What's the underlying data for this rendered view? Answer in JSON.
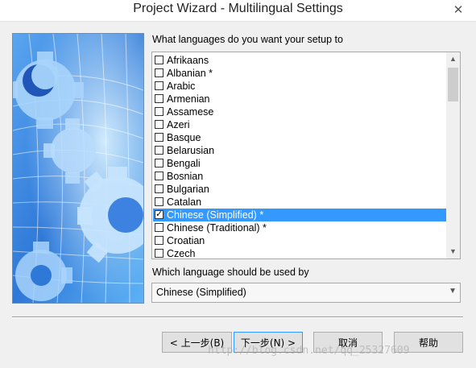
{
  "window": {
    "title": "Project Wizard - Multilingual Settings",
    "close_glyph": "✕"
  },
  "languages_prompt": "What languages do you want your setup to",
  "languages": [
    {
      "label": "Afrikaans",
      "checked": false,
      "selected": false
    },
    {
      "label": "Albanian *",
      "checked": false,
      "selected": false
    },
    {
      "label": "Arabic",
      "checked": false,
      "selected": false
    },
    {
      "label": "Armenian",
      "checked": false,
      "selected": false
    },
    {
      "label": "Assamese",
      "checked": false,
      "selected": false
    },
    {
      "label": "Azeri",
      "checked": false,
      "selected": false
    },
    {
      "label": "Basque",
      "checked": false,
      "selected": false
    },
    {
      "label": "Belarusian",
      "checked": false,
      "selected": false
    },
    {
      "label": "Bengali",
      "checked": false,
      "selected": false
    },
    {
      "label": "Bosnian",
      "checked": false,
      "selected": false
    },
    {
      "label": "Bulgarian",
      "checked": false,
      "selected": false
    },
    {
      "label": "Catalan",
      "checked": false,
      "selected": false
    },
    {
      "label": "Chinese (Simplified) *",
      "checked": true,
      "selected": true
    },
    {
      "label": "Chinese (Traditional) *",
      "checked": false,
      "selected": false
    },
    {
      "label": "Croatian",
      "checked": false,
      "selected": false
    },
    {
      "label": "Czech",
      "checked": false,
      "selected": false
    }
  ],
  "default_prompt": "Which language should be used by",
  "default_language": {
    "value": "Chinese (Simplified)"
  },
  "buttons": {
    "back": "< 上一步(B)",
    "next": "下一步(N) >",
    "cancel": "取消",
    "help": "帮助"
  },
  "watermark": "http://blog.csdn.net/qq_25327609",
  "colors": {
    "selection": "#3399ff",
    "art_background": "#3d82e0"
  },
  "icons": {
    "close": "close-icon",
    "scroll_up": "chevron-up-icon",
    "scroll_down": "chevron-down-icon",
    "dropdown": "chevron-down-icon",
    "checkmark": "checkmark-icon",
    "art": "gears-globe-illustration"
  }
}
